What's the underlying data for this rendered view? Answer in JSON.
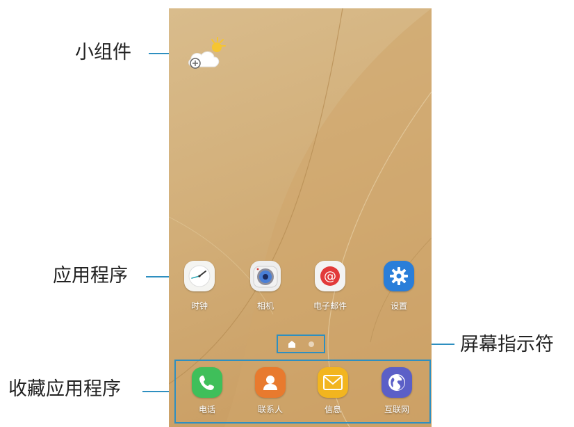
{
  "callouts": {
    "widget": "小组件",
    "apps": "应用程序",
    "page_indicator": "屏幕指示符",
    "favorites": "收藏应用程序"
  },
  "apps": [
    {
      "label": "时钟",
      "icon": "clock-icon"
    },
    {
      "label": "相机",
      "icon": "camera-icon"
    },
    {
      "label": "电子邮件",
      "icon": "email-icon"
    },
    {
      "label": "设置",
      "icon": "settings-gear-icon"
    }
  ],
  "favorites": [
    {
      "label": "电话",
      "icon": "phone-icon"
    },
    {
      "label": "联系人",
      "icon": "contacts-icon"
    },
    {
      "label": "信息",
      "icon": "message-envelope-icon"
    },
    {
      "label": "互联网",
      "icon": "internet-globe-icon"
    }
  ],
  "widget_icon": "weather-add-widget-icon",
  "page_indicator_icons": [
    "home-page-icon",
    "page-dot-icon"
  ],
  "colors": {
    "callout_line": "#2e8fc0",
    "wallpaper": "#d2ae78",
    "phone_app": "#3fbf5a",
    "contacts_app": "#e87a2e",
    "messages_app": "#f2b51f",
    "internet_app": "#5b5fc7",
    "settings_app": "#2a7ed9"
  }
}
